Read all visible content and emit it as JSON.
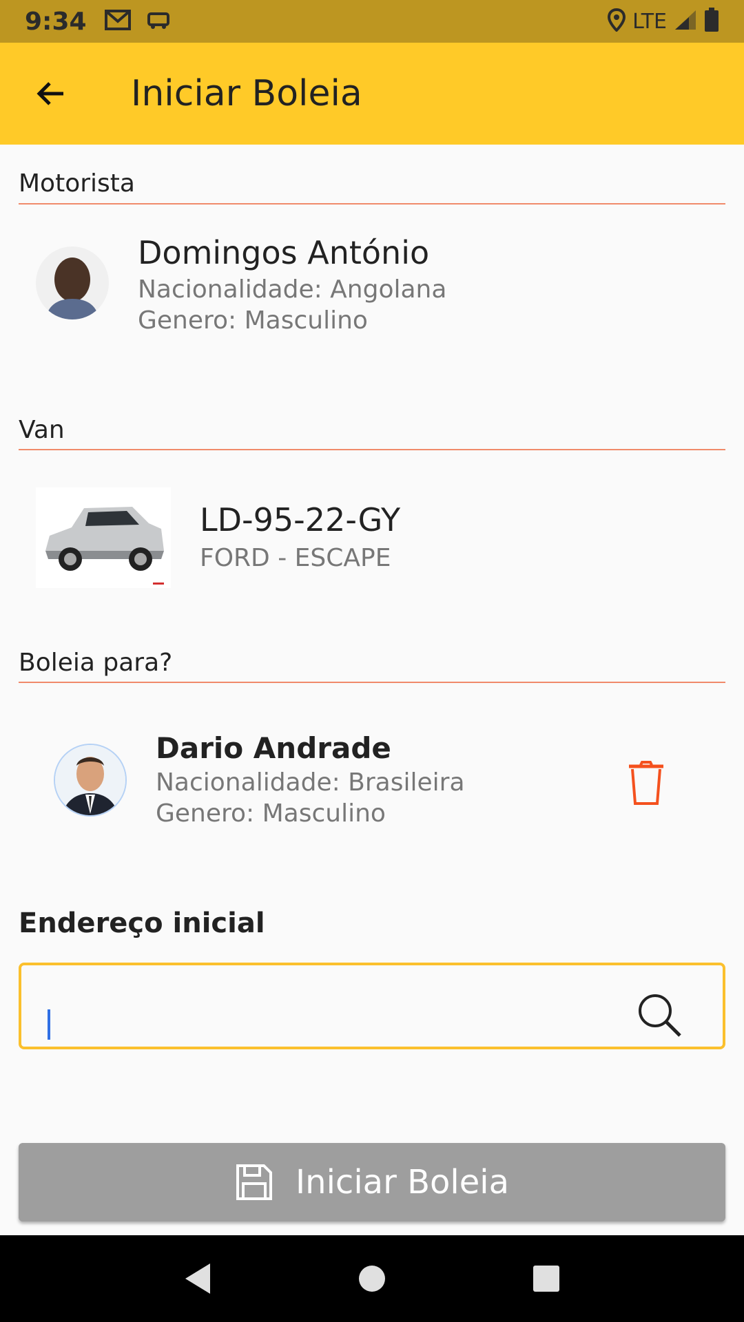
{
  "status_bar": {
    "time": "9:34",
    "network": "LTE",
    "icons": [
      "gmail-icon",
      "car-notification-icon",
      "location-icon",
      "signal-icon",
      "battery-icon"
    ]
  },
  "app_bar": {
    "title": "Iniciar Boleia",
    "back_icon": "arrow-back-icon",
    "color": "#ffca28"
  },
  "driver_section": {
    "label": "Motorista",
    "name": "Domingos António",
    "nationality": "Nacionalidade: Angolana",
    "gender": "Genero: Masculino"
  },
  "van_section": {
    "label": "Van",
    "plate": "LD-95-22-GY",
    "model": "FORD - ESCAPE"
  },
  "passenger_section": {
    "label": "Boleia para?",
    "name": "Dario Andrade",
    "nationality": "Nacionalidade: Brasileira",
    "gender": "Genero: Masculino",
    "delete_icon": "trash-icon",
    "delete_color": "#f4511e"
  },
  "address": {
    "label": "Endereço inicial",
    "value": "",
    "placeholder": "",
    "search_icon": "search-icon",
    "border_color": "#fbc02d"
  },
  "submit": {
    "label": "Iniciar Boleia",
    "icon": "save-icon",
    "color": "#9e9e9e"
  },
  "nav_bar": {
    "buttons": [
      "back-triangle-icon",
      "home-circle-icon",
      "recents-square-icon"
    ]
  }
}
